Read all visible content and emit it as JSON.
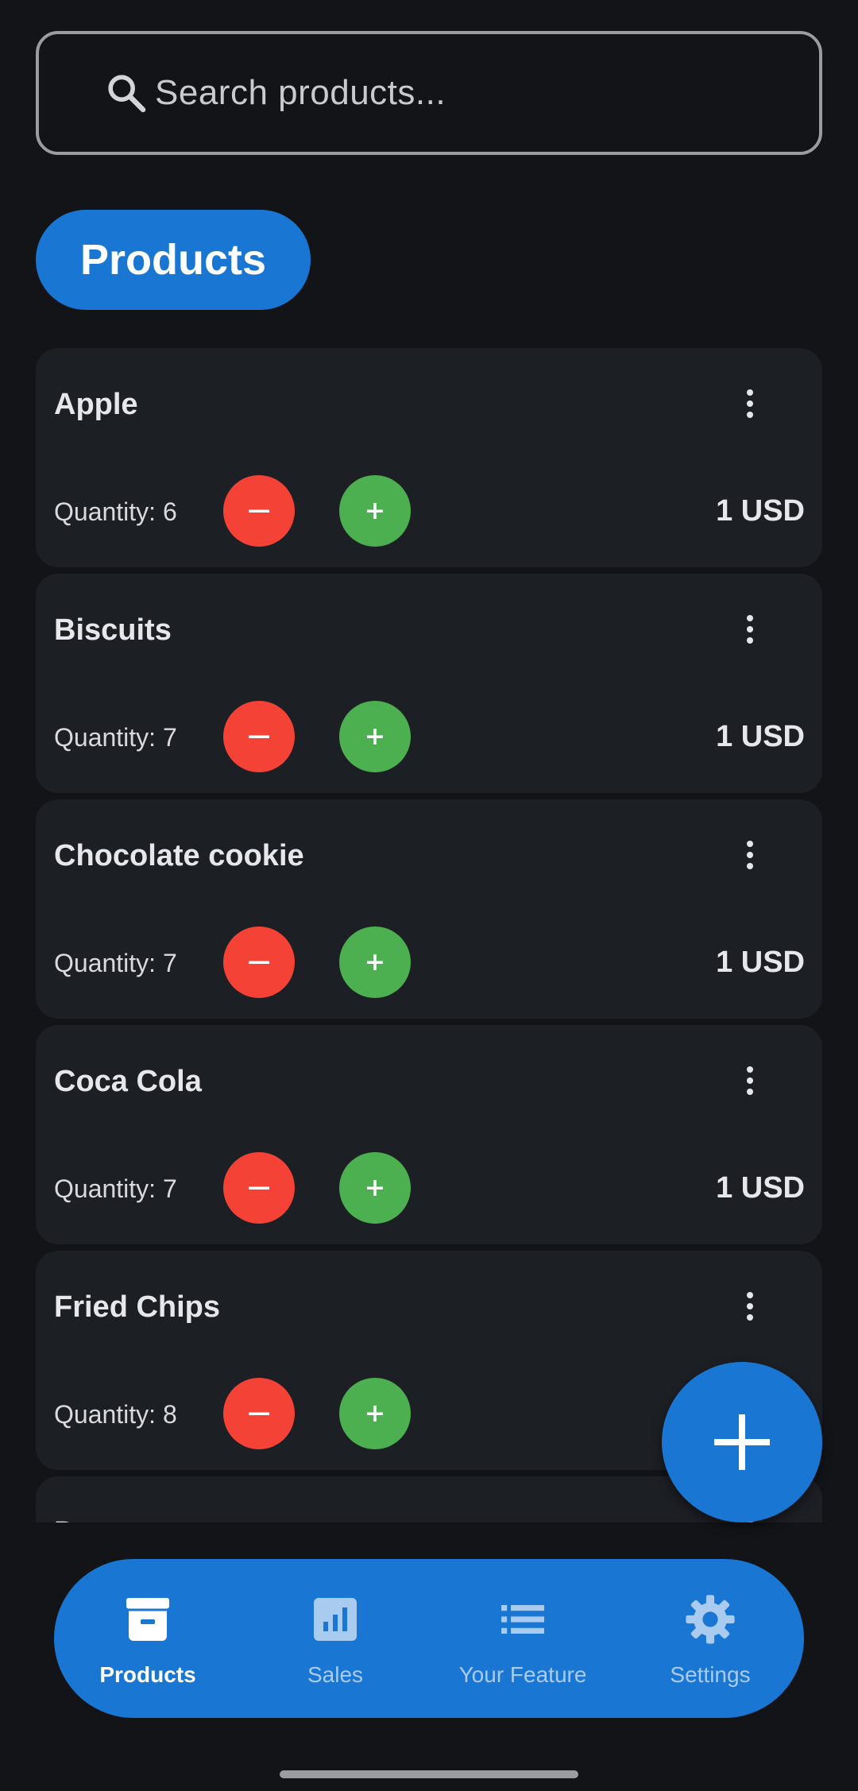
{
  "search": {
    "placeholder": "Search products..."
  },
  "header": {
    "chip_label": "Products"
  },
  "products": [
    {
      "name": "Apple",
      "quantity": "Quantity: 6",
      "price": "1 USD"
    },
    {
      "name": "Biscuits",
      "quantity": "Quantity: 7",
      "price": "1 USD"
    },
    {
      "name": "Chocolate cookie",
      "quantity": "Quantity: 7",
      "price": "1 USD"
    },
    {
      "name": "Coca Cola",
      "quantity": "Quantity: 7",
      "price": "1 USD"
    },
    {
      "name": "Fried Chips",
      "quantity": "Quantity: 8",
      "price": ""
    },
    {
      "name": "Donuts",
      "quantity": "",
      "price": ""
    }
  ],
  "nav": {
    "items": [
      {
        "label": "Products",
        "icon": "archive-icon",
        "active": true
      },
      {
        "label": "Sales",
        "icon": "bar-chart-icon",
        "active": false
      },
      {
        "label": "Your Feature",
        "icon": "list-icon",
        "active": false
      },
      {
        "label": "Settings",
        "icon": "gear-icon",
        "active": false
      }
    ]
  },
  "colors": {
    "background": "#121418",
    "card": "#1c1f24",
    "accent": "#1976d2",
    "minus": "#f44336",
    "plus": "#4caf50",
    "nav_inactive": "#a9cbef"
  }
}
